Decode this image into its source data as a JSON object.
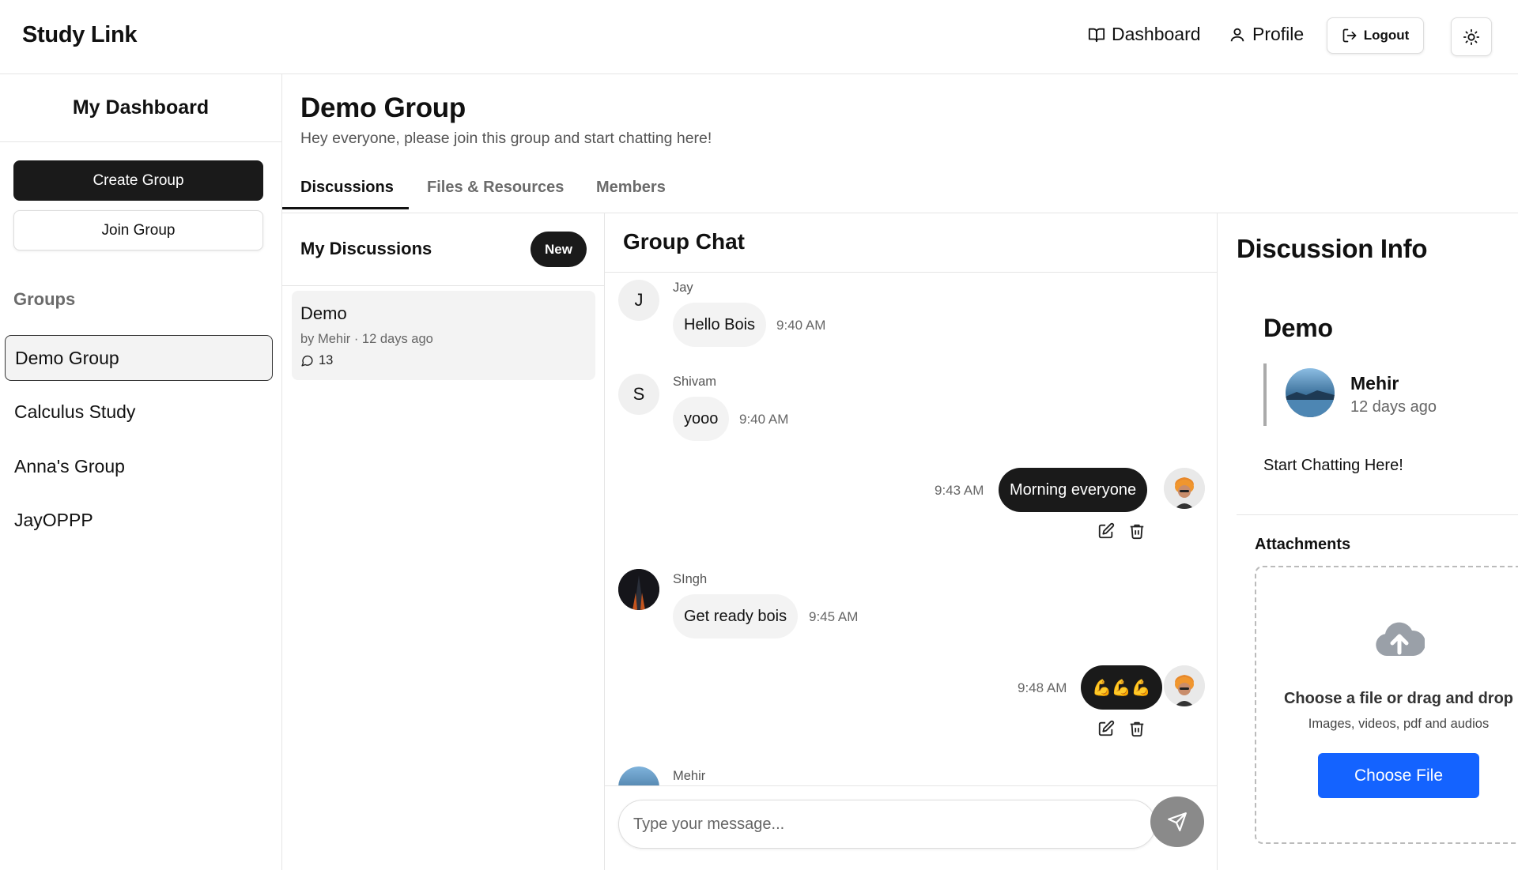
{
  "header": {
    "brand": "Study Link",
    "nav": {
      "dashboard": "Dashboard",
      "profile": "Profile",
      "logout": "Logout"
    }
  },
  "sidebar": {
    "title": "My Dashboard",
    "create_group": "Create Group",
    "join_group": "Join Group",
    "groups_label": "Groups",
    "groups": [
      {
        "name": "Demo Group",
        "active": true
      },
      {
        "name": "Calculus Study",
        "active": false
      },
      {
        "name": "Anna's Group",
        "active": false
      },
      {
        "name": "JayOPPP",
        "active": false
      }
    ]
  },
  "group": {
    "title": "Demo Group",
    "description": "Hey everyone, please join this group and start chatting here!",
    "tabs": [
      "Discussions",
      "Files & Resources",
      "Members"
    ],
    "active_tab": "Discussions"
  },
  "discussions": {
    "title": "My Discussions",
    "new_button": "New",
    "items": [
      {
        "title": "Demo",
        "meta": "by Mehir · 12 days ago",
        "comments": "13"
      }
    ]
  },
  "chat": {
    "title": "Group Chat",
    "messages": [
      {
        "initial": "J",
        "author": "Jay",
        "text": "Hello Bois",
        "time": "9:40 AM",
        "mine": false
      },
      {
        "initial": "S",
        "author": "Shivam",
        "text": "yooo",
        "time": "9:40 AM",
        "mine": false
      },
      {
        "initial": "",
        "author": "",
        "text": "Morning everyone",
        "time": "9:43 AM",
        "mine": true
      },
      {
        "initial": "",
        "author": "SIngh",
        "text": "Get ready bois",
        "time": "9:45 AM",
        "mine": false
      },
      {
        "initial": "",
        "author": "",
        "text": "💪💪💪",
        "time": "9:48 AM",
        "mine": true
      },
      {
        "initial": "",
        "author": "Mehir",
        "text": "",
        "time": "",
        "mine": false
      }
    ],
    "input_placeholder": "Type your message..."
  },
  "info": {
    "title": "Discussion Info",
    "discussion_title": "Demo",
    "author": "Mehir",
    "author_time": "12 days ago",
    "content": "Start Chatting Here!",
    "attachments_label": "Attachments",
    "dropzone_title": "Choose a file or drag and drop",
    "dropzone_subtitle": "Images, videos, pdf and audios",
    "choose_file": "Choose File"
  },
  "colors": {
    "primary_dark": "#1a1a1a",
    "accent_blue": "#1463ff",
    "muted_text": "#6b6b6b",
    "bubble_in": "#f3f3f3",
    "border": "#e5e5e5"
  }
}
